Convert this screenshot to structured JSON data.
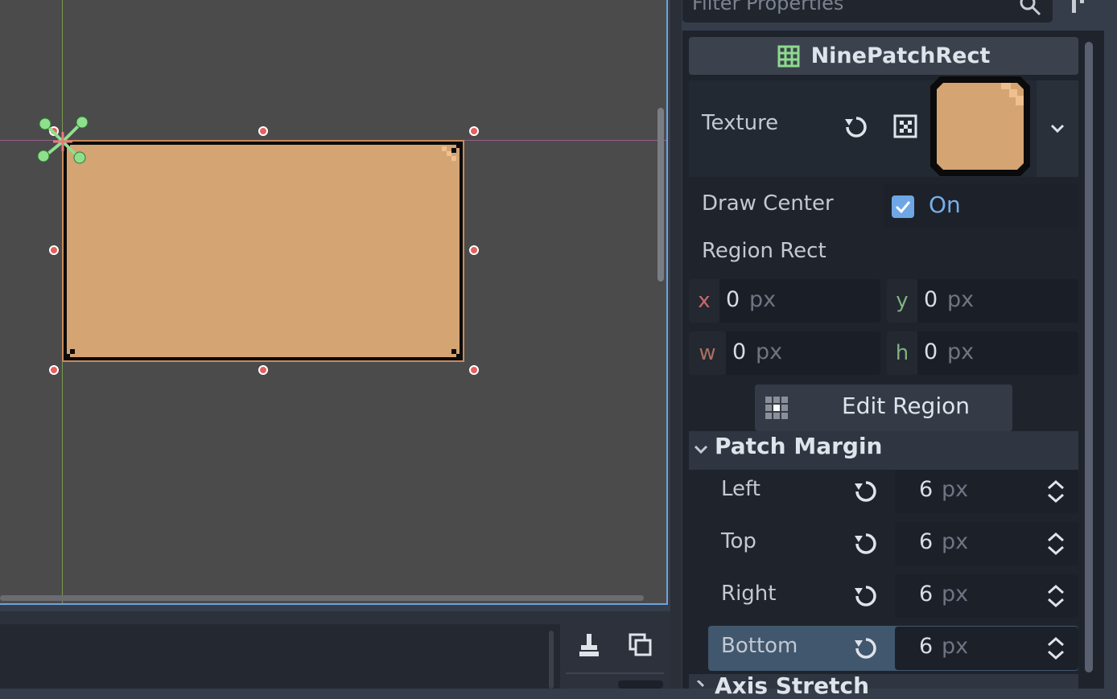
{
  "inspector": {
    "filter_placeholder": "Filter Properties",
    "class_name": "NinePatchRect",
    "texture": {
      "label": "Texture"
    },
    "draw_center": {
      "label": "Draw Center",
      "checked": true,
      "value_label": "On"
    },
    "region_rect": {
      "label": "Region Rect",
      "x": {
        "axis": "x",
        "value": "0",
        "unit": "px"
      },
      "y": {
        "axis": "y",
        "value": "0",
        "unit": "px"
      },
      "w": {
        "axis": "w",
        "value": "0",
        "unit": "px"
      },
      "h": {
        "axis": "h",
        "value": "0",
        "unit": "px"
      }
    },
    "edit_region_label": "Edit Region",
    "patch_margin": {
      "label": "Patch Margin",
      "left": {
        "label": "Left",
        "value": "6",
        "unit": "px"
      },
      "top": {
        "label": "Top",
        "value": "6",
        "unit": "px"
      },
      "right": {
        "label": "Right",
        "value": "6",
        "unit": "px"
      },
      "bottom": {
        "label": "Bottom",
        "value": "6",
        "unit": "px",
        "selected": true
      }
    },
    "axis_stretch_label": "Axis Stretch"
  },
  "colors": {
    "accent": "#6ea7e6",
    "panel_fill": "#d4a472",
    "handle": "#e55f5f",
    "pivot": "#8fdf8f",
    "axis_x": "#c96b6b",
    "axis_y": "#7fb07f"
  }
}
